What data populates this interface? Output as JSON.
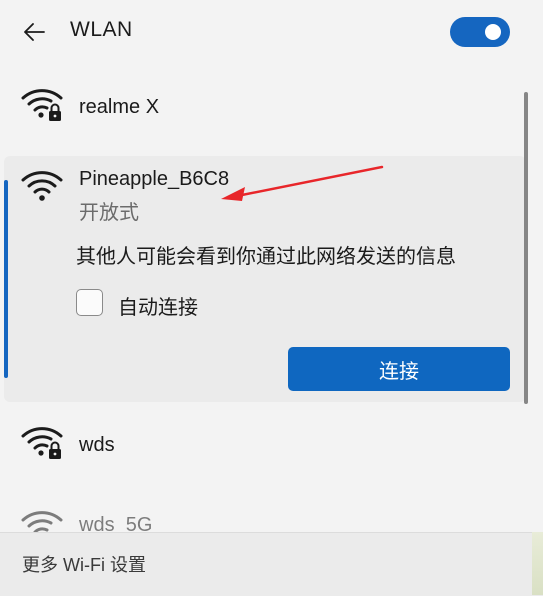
{
  "header": {
    "title": "WLAN",
    "back_icon": "arrow-left-icon",
    "wifi_toggle_on": true,
    "accent_color": "#1566c0"
  },
  "networks": [
    {
      "name": "realme X",
      "icon": "wifi-secured-icon",
      "secured": true
    },
    {
      "name": "Pineapple_B6C8",
      "icon": "wifi-open-icon",
      "secured": false,
      "status": "开放式",
      "warning": "其他人可能会看到你通过此网络发送的信息",
      "auto_connect_label": "自动连接",
      "auto_connect_checked": false,
      "connect_label": "连接",
      "expanded": true
    },
    {
      "name": "wds",
      "icon": "wifi-secured-icon",
      "secured": true
    },
    {
      "name": "wds_5G",
      "icon": "wifi-secured-icon",
      "secured": true
    }
  ],
  "footer": {
    "more_settings_label": "更多 Wi-Fi 设置"
  },
  "annotation": {
    "arrow_color": "#e8262a"
  }
}
